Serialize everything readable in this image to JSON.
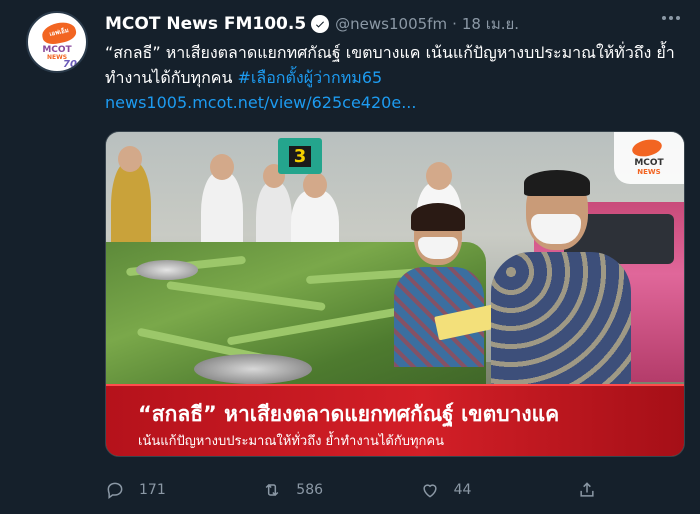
{
  "avatar": {
    "brand_top": "เอฟเอ็ม",
    "brand_mcot": "MCOT",
    "brand_news": "NEWS",
    "brand_anniv": "70"
  },
  "tweet": {
    "name": "MCOT News FM100.5",
    "handle": "@news1005fm",
    "separator": "·",
    "date": "18 เม.ย.",
    "text_part1": "“สกลธี” หาเสียงตลาดแยกทศกัณฐ์ เขตบางแค เน้นแก้ปัญหางบประมาณให้ทั่วถึง  ย้ำทำงานได้กับทุกคน ",
    "hashtag": "#เลือกตั้งผู้ว่ากทม65",
    "link": "news1005.mcot.net/view/625ce420e..."
  },
  "media": {
    "sign_number": "3",
    "logo_mcot": "MCOT",
    "logo_news": "NEWS",
    "caption_title": "“สกลธี” หาเสียงตลาดแยกทศกัณฐ์ เขตบางแค",
    "caption_sub": "เน้นแก้ปัญหางบประมาณให้ทั่วถึง ย้ำทำงานได้กับทุกคน"
  },
  "actions": {
    "replies": "171",
    "retweets": "586",
    "likes": "44"
  },
  "colors": {
    "background": "#15202b",
    "text": "#ffffff",
    "muted": "#8b98a5",
    "link": "#1d9bf0",
    "caption_red": "#d31f27"
  },
  "icons": [
    "verified-badge-icon",
    "more-icon",
    "reply-icon",
    "retweet-icon",
    "like-icon",
    "share-icon"
  ]
}
